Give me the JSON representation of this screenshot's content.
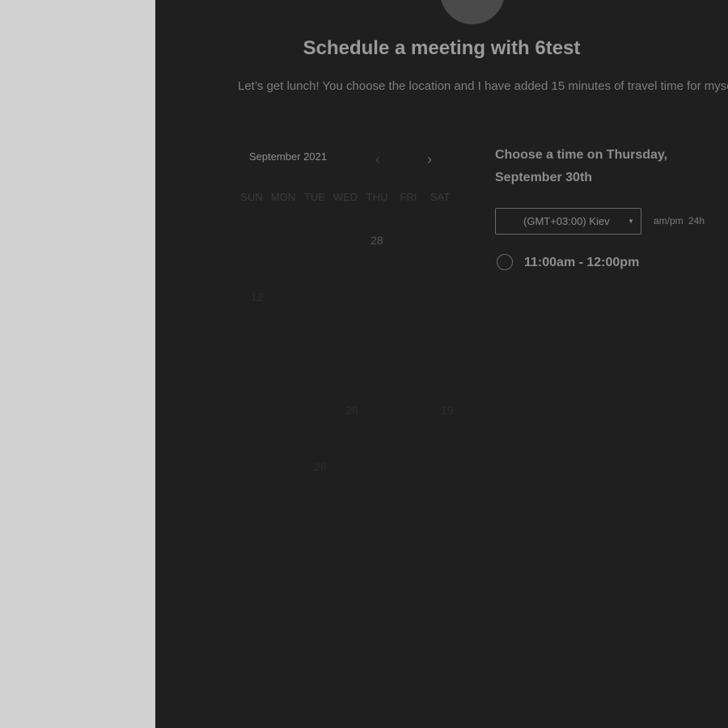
{
  "page": {
    "title": "Schedule a meeting with 6test",
    "description": "Let’s get lunch! You choose the location and I have added 15 minutes of travel time for myself."
  },
  "calendar": {
    "month_label": "September 2021",
    "prev_icon": "chevron-left-icon",
    "next_icon": "chevron-right-icon",
    "weekdays": [
      "SUN",
      "MON",
      "TUE",
      "WED",
      "THU",
      "FRI",
      "SAT"
    ],
    "days": [
      {
        "text": "28"
      },
      {
        "text": "12"
      },
      {
        "text": "28"
      },
      {
        "text": "19"
      },
      {
        "text": "28"
      }
    ]
  },
  "times": {
    "heading": "Choose a time on Thursday, September 30th",
    "timezone": "(GMT+03:00) Kiev",
    "format_ampm": "am/pm",
    "format_24h": "24h",
    "slots": [
      {
        "label": "11:00am - 12:00pm"
      }
    ]
  },
  "colors": {
    "panel_bg": "#1f1f1f",
    "page_bg": "#d2d2d2"
  }
}
